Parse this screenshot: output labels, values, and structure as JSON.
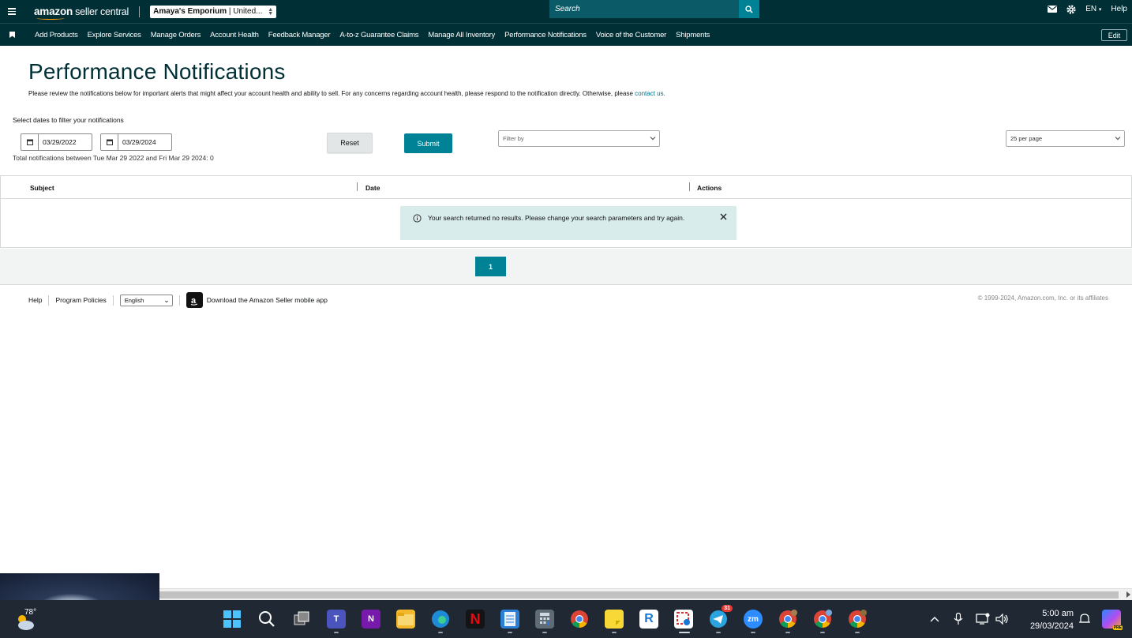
{
  "header": {
    "logo_brand": "amazon",
    "logo_product": "seller central",
    "store_name": "Amaya's Emporium",
    "store_region": "| United...",
    "search_placeholder": "Search",
    "language": "EN",
    "help_label": "Help"
  },
  "nav": {
    "items": [
      "Add Products",
      "Explore Services",
      "Manage Orders",
      "Account Health",
      "Feedback Manager",
      "A-to-z Guarantee Claims",
      "Manage All Inventory",
      "Performance Notifications",
      "Voice of the Customer",
      "Shipments"
    ],
    "edit_label": "Edit"
  },
  "page": {
    "title": "Performance Notifications",
    "intro": "Please review the notifications below for important alerts that might affect your account health and ability to sell. For any concerns regarding account health, please respond to the notification directly. Otherwise, please ",
    "contact_link": "contact us.",
    "date_filter_label": "Select dates to filter your notifications",
    "start_date": "03/29/2022",
    "end_date": "03/29/2024",
    "total_line": "Total notifications between Tue Mar 29 2022 and Fri Mar 29 2024: 0",
    "reset_label": "Reset",
    "submit_label": "Submit",
    "filter_placeholder": "Filter by",
    "per_page": "25 per page"
  },
  "table": {
    "headers": [
      "Subject",
      "Date",
      "Actions"
    ],
    "empty_message": "Your search returned no results. Please change your search parameters and try again."
  },
  "pagination": {
    "current_page": "1"
  },
  "footer": {
    "help": "Help",
    "program_policies": "Program Policies",
    "language_select": "English",
    "app_download": "Download the Amazon Seller mobile app",
    "copyright": "© 1999-2024, Amazon.com, Inc. or its affiliates"
  },
  "taskbar": {
    "weather_temp": "78°",
    "telegram_badge": "31",
    "time": "5:00 am",
    "date": "29/03/2024"
  },
  "colors": {
    "header_bg": "#002f36",
    "accent": "#008296",
    "alert_bg": "#d9ecec",
    "taskbar_bg": "#1f2833"
  }
}
